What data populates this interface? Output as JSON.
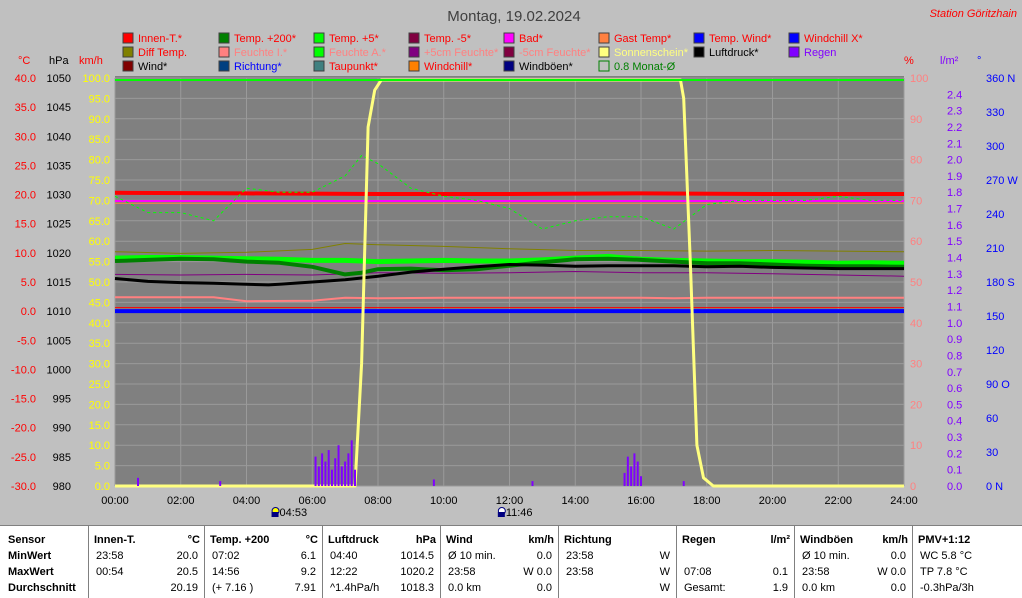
{
  "title": "Montag, 19.02.2024",
  "station": "Station Göritzhain",
  "axis_units": {
    "temp": "°C",
    "hpa": "hPa",
    "kmh": "km/h",
    "pct": "%",
    "lm2": "l/m²",
    "deg": "°"
  },
  "legend": [
    [
      {
        "label": "Innen-T.*",
        "color": "#ff0000",
        "text_color": "#ff0000"
      },
      {
        "label": "Temp. +200*",
        "color": "#008000",
        "text_color": "#ff0000"
      },
      {
        "label": "Temp. +5*",
        "color": "#00ff00",
        "text_color": "#ff0000"
      },
      {
        "label": "Temp. -5*",
        "color": "#800040",
        "text_color": "#ff0000"
      },
      {
        "label": "Bad*",
        "color": "#ff00ff",
        "text_color": "#ff0000"
      },
      {
        "label": "Gast Temp*",
        "color": "#ff8040",
        "text_color": "#ff0000"
      },
      {
        "label": "Temp. Wind*",
        "color": "#0000ff",
        "text_color": "#ff0000"
      },
      {
        "label": "Windchill X*",
        "color": "#0000ff",
        "text_color": "#ff0000"
      }
    ],
    [
      {
        "label": "Diff Temp.",
        "color": "#808000",
        "text_color": "#ff0000"
      },
      {
        "label": "Feuchte I.*",
        "color": "#ff8080",
        "text_color": "#ff8080"
      },
      {
        "label": "Feuchte A.*",
        "color": "#00ff00",
        "text_color": "#ff8080"
      },
      {
        "label": "+5cm Feuchte*",
        "color": "#800080",
        "text_color": "#ff8080"
      },
      {
        "label": "-5cm Feuchte*",
        "color": "#800040",
        "text_color": "#ff8080"
      },
      {
        "label": "Sonnenschein*",
        "color": "#ffff80",
        "text_color": "#ffff80"
      },
      {
        "label": "Luftdruck*",
        "color": "#000000",
        "text_color": "#000000"
      },
      {
        "label": "Regen",
        "color": "#8000ff",
        "text_color": "#8000ff"
      }
    ],
    [
      {
        "label": "Wind*",
        "color": "#800000",
        "text_color": "#000000"
      },
      {
        "label": "Richtung*",
        "color": "#004080",
        "text_color": "#0000ff"
      },
      {
        "label": "Taupunkt*",
        "color": "#408080",
        "text_color": "#ff0000"
      },
      {
        "label": "Windchill*",
        "color": "#ff8000",
        "text_color": "#ff0000"
      },
      {
        "label": "Windböen*",
        "color": "#000080",
        "text_color": "#000000"
      },
      {
        "label": "0.8 Monat-Ø",
        "color": "#008000",
        "text_color": "#008000",
        "hollow": true
      }
    ]
  ],
  "chart_data": {
    "type": "line",
    "title": "Montag, 19.02.2024",
    "x_ticks": [
      "00:00",
      "02:00",
      "04:00",
      "06:00",
      "08:00",
      "10:00",
      "12:00",
      "14:00",
      "16:00",
      "18:00",
      "20:00",
      "22:00",
      "24:00"
    ],
    "x_range_hours": [
      0,
      24
    ],
    "y_axes": {
      "temp_c": {
        "ticks": [
          "40.0",
          "35.0",
          "30.0",
          "25.0",
          "20.0",
          "15.0",
          "10.0",
          "5.0",
          "0.0",
          "-5.0",
          "-10.0",
          "-15.0",
          "-20.0",
          "-25.0",
          "-30.0"
        ],
        "range": [
          -30,
          40
        ],
        "color": "#ff0000"
      },
      "pressure_hpa": {
        "ticks": [
          "1050",
          "1045",
          "1040",
          "1035",
          "1030",
          "1025",
          "1020",
          "1015",
          "1010",
          "1005",
          "1000",
          "995",
          "990",
          "985",
          "980"
        ],
        "range": [
          980,
          1050
        ],
        "color": "#000000"
      },
      "wind_kmh": {
        "ticks": [
          "100.0",
          "95.0",
          "90.0",
          "85.0",
          "80.0",
          "75.0",
          "70.0",
          "65.0",
          "60.0",
          "55.0",
          "50.0",
          "45.0",
          "40.0",
          "35.0",
          "30.0",
          "25.0",
          "20.0",
          "15.0",
          "10.0",
          "5.0",
          "0.0"
        ],
        "range": [
          0,
          100
        ],
        "color": "#ffff00"
      },
      "humidity_pct": {
        "ticks": [
          "100",
          "90",
          "80",
          "70",
          "60",
          "50",
          "40",
          "30",
          "20",
          "10",
          "0"
        ],
        "range": [
          0,
          100
        ],
        "color": "#ff8080"
      },
      "rain_lm2": {
        "ticks": [
          "2.4",
          "2.3",
          "2.2",
          "2.1",
          "2.0",
          "1.9",
          "1.8",
          "1.7",
          "1.6",
          "1.5",
          "1.4",
          "1.3",
          "1.2",
          "1.1",
          "1.0",
          "0.9",
          "0.8",
          "0.7",
          "0.6",
          "0.5",
          "0.4",
          "0.3",
          "0.2",
          "0.1",
          "0.0"
        ],
        "range": [
          0,
          2.5
        ],
        "color": "#8000ff"
      },
      "direction": {
        "ticks": [
          "360 N",
          "330",
          "300",
          "270 W",
          "240",
          "210",
          "180 S",
          "150",
          "120",
          "90 O",
          "60",
          "30",
          "0    N"
        ],
        "range": [
          0,
          360
        ],
        "color": "#0000ff"
      }
    },
    "series": [
      {
        "name": "Innen-T.*",
        "color": "#ff0000",
        "width": 4,
        "axis": "temp_c",
        "x": [
          0,
          4,
          8,
          12,
          16,
          20,
          24
        ],
        "y": [
          20.3,
          20.2,
          20.1,
          20.1,
          20.2,
          20.1,
          20.1
        ]
      },
      {
        "name": "Bad*",
        "color": "#ff00ff",
        "width": 2,
        "axis": "temp_c",
        "x": [
          0,
          6,
          12,
          18,
          24
        ],
        "y": [
          18.9,
          18.9,
          18.9,
          18.9,
          18.9
        ]
      },
      {
        "name": "Gast Temp*",
        "color": "#ff8040",
        "width": 1,
        "axis": "temp_c",
        "x": [
          0,
          6,
          12,
          18,
          24
        ],
        "y": [
          18.5,
          18.5,
          18.5,
          18.5,
          18.5
        ]
      },
      {
        "name": "Temp. Wind*",
        "color": "#0000ff",
        "width": 4,
        "axis": "temp_c",
        "x": [
          0,
          24
        ],
        "y": [
          0.0,
          0.0
        ]
      },
      {
        "name": "Windchill*",
        "color": "#ff0000",
        "width": 1,
        "axis": "temp_c",
        "x": [
          0,
          24
        ],
        "y": [
          0.6,
          0.6
        ]
      },
      {
        "name": "Feuchte I.*",
        "color": "#ff8080",
        "width": 2,
        "axis": "temp_c",
        "x": [
          0,
          3,
          4,
          6,
          7,
          8,
          10,
          12,
          14,
          16,
          17,
          18,
          20,
          22,
          24
        ],
        "y": [
          2.4,
          2.4,
          1.7,
          1.8,
          2.3,
          2.2,
          2.3,
          2.3,
          2.3,
          2.3,
          2.2,
          2.3,
          2.3,
          2.3,
          2.3
        ]
      },
      {
        "name": "+5cm Feuchte*",
        "color": "#800080",
        "width": 1,
        "axis": "temp_c",
        "x": [
          0,
          2,
          4,
          6,
          8,
          10,
          12,
          14,
          16,
          18,
          20,
          22,
          24
        ],
        "y": [
          6.3,
          6.2,
          6.3,
          6.2,
          6.6,
          6.5,
          6.6,
          6.8,
          6.6,
          6.6,
          6.4,
          6.2,
          6.0
        ]
      },
      {
        "name": "Temp. +5*",
        "color": "#00ff00",
        "width": 5,
        "axis": "temp_c",
        "x": [
          0,
          1,
          2,
          3,
          4,
          5,
          6,
          7,
          8,
          9,
          10,
          11,
          12,
          13,
          14,
          15,
          16,
          17,
          18,
          19,
          20,
          21,
          22,
          23,
          24
        ],
        "y": [
          9.1,
          9.2,
          9.2,
          9.1,
          9.0,
          8.9,
          8.7,
          8.7,
          8.5,
          8.6,
          8.7,
          8.6,
          8.6,
          8.8,
          9.1,
          9.4,
          8.9,
          8.7,
          8.6,
          8.5,
          8.5,
          8.4,
          8.2,
          8.3,
          8.2
        ]
      },
      {
        "name": "Temp. +200*",
        "color": "#008000",
        "width": 4,
        "axis": "temp_c",
        "x": [
          0,
          1,
          2,
          3,
          4,
          5,
          6,
          7,
          7.5,
          8,
          9,
          10,
          11,
          12,
          13,
          14,
          15,
          16,
          17,
          18,
          19,
          20,
          21,
          22,
          23,
          24
        ],
        "y": [
          8.6,
          8.8,
          9.0,
          8.9,
          8.5,
          8.3,
          7.6,
          6.3,
          6.6,
          7.2,
          7.3,
          7.0,
          7.2,
          7.8,
          8.4,
          8.9,
          9.0,
          8.8,
          8.5,
          8.2,
          8.2,
          8.0,
          7.8,
          7.7,
          7.7,
          7.6
        ]
      },
      {
        "name": "Luftdruck*",
        "color": "#000000",
        "width": 3,
        "axis": "pressure_hpa",
        "x": [
          0,
          1,
          2,
          3,
          4,
          4.67,
          5,
          6,
          7,
          8,
          9,
          10,
          11,
          12,
          13,
          14,
          15,
          16,
          17,
          18,
          19,
          20,
          21,
          22,
          23,
          24
        ],
        "y": [
          1015.6,
          1015.1,
          1014.9,
          1014.8,
          1014.6,
          1014.5,
          1014.6,
          1015.0,
          1015.4,
          1016.0,
          1016.7,
          1017.2,
          1017.6,
          1018.0,
          1017.9,
          1017.7,
          1017.8,
          1017.8,
          1017.8,
          1017.6,
          1017.7,
          1017.5,
          1017.4,
          1017.3,
          1017.3,
          1017.3
        ]
      },
      {
        "name": "Diff Temp.",
        "color": "#808000",
        "width": 1,
        "axis": "temp_c",
        "x": [
          0,
          2,
          4,
          6,
          7,
          8,
          10,
          12,
          14,
          16,
          18,
          20,
          22,
          24
        ],
        "y": [
          10.2,
          9.9,
          10.1,
          10.6,
          11.6,
          11.4,
          11.1,
          10.7,
          10.4,
          10.4,
          10.3,
          10.4,
          10.3,
          10.2
        ]
      },
      {
        "name": "Feuchte A.*",
        "color": "#00ff00",
        "width": 1,
        "dashed": true,
        "axis": "humidity_pct",
        "x": [
          0,
          1,
          2,
          3,
          4,
          5,
          6,
          7,
          7.5,
          8,
          9,
          10,
          11,
          12,
          13,
          14,
          15,
          16,
          17,
          18,
          19,
          20,
          21,
          22,
          23,
          24
        ],
        "y": [
          71,
          67,
          67,
          65,
          73,
          72,
          72,
          76,
          81,
          79,
          73,
          71,
          70,
          68,
          63,
          65,
          66,
          66,
          63,
          69,
          70,
          70,
          70,
          71,
          70,
          70
        ]
      },
      {
        "name": "Sonnenschein*",
        "color": "#ffff80",
        "width": 3,
        "axis": "wind_kmh",
        "x": [
          0,
          7.3,
          7.5,
          7.7,
          7.9,
          8.1,
          17.2,
          17.3,
          17.5,
          17.7,
          17.9,
          18.2,
          24
        ],
        "y": [
          0,
          0,
          30,
          88,
          97,
          99.5,
          99.5,
          95,
          55,
          10,
          2,
          0,
          0
        ]
      },
      {
        "name": "0.8 Monat-Ø",
        "color": "#00ff00",
        "width": 2,
        "axis": "wind_kmh",
        "x": [
          0,
          24
        ],
        "y": [
          99.5,
          99.5
        ]
      },
      {
        "name": "Regen",
        "color": "#8000ff",
        "width": 1,
        "axis": "rain_lm2",
        "type": "bars",
        "x": [
          0.7,
          3.2,
          6.1,
          6.2,
          6.3,
          6.4,
          6.5,
          6.6,
          6.7,
          6.8,
          6.9,
          7.0,
          7.1,
          7.2,
          7.3,
          9.7,
          12.7,
          15.5,
          15.6,
          15.7,
          15.8,
          15.9,
          16.0,
          17.3
        ],
        "y": [
          0.05,
          0.03,
          0.18,
          0.12,
          0.2,
          0.15,
          0.22,
          0.1,
          0.17,
          0.25,
          0.12,
          0.15,
          0.2,
          0.28,
          0.1,
          0.04,
          0.03,
          0.08,
          0.18,
          0.12,
          0.2,
          0.15,
          0.06,
          0.03
        ]
      }
    ],
    "markers": [
      {
        "time": "04:53",
        "icon": "sunrise-icon"
      },
      {
        "time": "11:46",
        "icon": "moon-icon"
      }
    ],
    "grid": true
  },
  "stats": {
    "row_labels": [
      "Sensor",
      "MinWert",
      "MaxWert",
      "Durchschnitt"
    ],
    "columns": [
      {
        "header": "Innen-T.",
        "unit": "°C",
        "rows": [
          [
            "23:58",
            "20.0"
          ],
          [
            "00:54",
            "20.5"
          ],
          [
            "",
            "20.19"
          ]
        ]
      },
      {
        "header": "Temp. +200",
        "unit": "°C",
        "rows": [
          [
            "07:02",
            "6.1"
          ],
          [
            "14:56",
            "9.2"
          ],
          [
            "(+ 7.16 )",
            "7.91"
          ]
        ]
      },
      {
        "header": "Luftdruck",
        "unit": "hPa",
        "rows": [
          [
            "04:40",
            "1014.5"
          ],
          [
            "12:22",
            "1020.2"
          ],
          [
            "^1.4hPa/h",
            "1018.3"
          ]
        ]
      },
      {
        "header": "Wind",
        "unit": "km/h",
        "rows": [
          [
            "Ø 10 min.",
            "0.0"
          ],
          [
            "23:58",
            "W 0.0"
          ],
          [
            "0.0 km",
            "0.0"
          ]
        ]
      },
      {
        "header": "Richtung",
        "unit": "",
        "rows": [
          [
            "23:58",
            "W"
          ],
          [
            "23:58",
            "W"
          ],
          [
            "",
            "W"
          ]
        ]
      },
      {
        "header": "Regen",
        "unit": "l/m²",
        "rows": [
          [
            "",
            ""
          ],
          [
            "07:08",
            "0.1"
          ],
          [
            "Gesamt:",
            "1.9"
          ]
        ]
      },
      {
        "header": "Windböen",
        "unit": "km/h",
        "rows": [
          [
            "Ø 10 min.",
            "0.0"
          ],
          [
            "23:58",
            "W 0.0"
          ],
          [
            "0.0 km",
            "0.0"
          ]
        ]
      },
      {
        "header": "PMV+1:12",
        "unit": "",
        "rows": [
          [
            "WC 5.8 °C",
            ""
          ],
          [
            "TP 7.8 °C",
            ""
          ],
          [
            "-0.3hPa/3h",
            ""
          ]
        ]
      }
    ]
  }
}
